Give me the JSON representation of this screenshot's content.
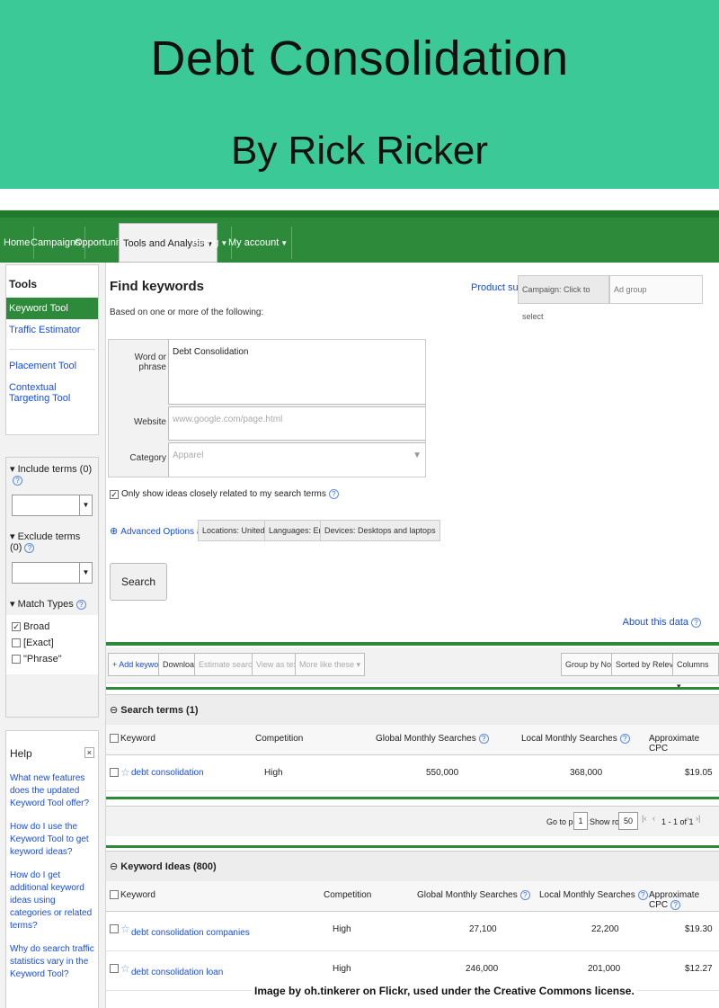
{
  "cover": {
    "title": "Debt Consolidation",
    "author": "By Rick Ricker",
    "bg_color": "#3bca97"
  },
  "nav": {
    "items": [
      "Home",
      "Campaigns",
      "Opportunities",
      "Tools and Analysis",
      "Billing",
      "My account"
    ],
    "active": "Tools and Analysis",
    "color": "#2d8a3a"
  },
  "sidebar": {
    "tools_title": "Tools",
    "tools": [
      "Keyword Tool",
      "Traffic Estimator",
      "Placement Tool",
      "Contextual Targeting Tool"
    ],
    "include_terms": "Include terms (0)",
    "exclude_terms": "Exclude terms (0)",
    "match_types_title": "Match Types",
    "match_types": [
      {
        "label": "Broad",
        "checked": true
      },
      {
        "label": "[Exact]",
        "checked": false
      },
      {
        "label": "\"Phrase\"",
        "checked": false
      }
    ],
    "help_title": "Help",
    "help_links": [
      "What new features does the updated Keyword Tool offer?",
      "How do I use the Keyword Tool to get keyword ideas?",
      "How do I get additional keyword ideas using categories or related terms?",
      "Why do search traffic statistics vary in the Keyword Tool?"
    ]
  },
  "find": {
    "title": "Find keywords",
    "subtitle": "Based on one or more of the following:",
    "product_survey": "Product survey",
    "campaign": "Campaign: Click to select",
    "ad_group": "Ad group",
    "word_label": "Word or phrase",
    "word_value": "Debt Consolidation",
    "website_label": "Website",
    "website_placeholder": "www.google.com/page.html",
    "category_label": "Category",
    "category_placeholder": "Apparel",
    "only_show": "Only show ideas closely related to my search terms",
    "advanced": "Advanced Options and Filters",
    "chips": [
      "Locations: United States",
      "Languages: English",
      "Devices: Desktops and laptops"
    ],
    "search_button": "Search",
    "about": "About this data"
  },
  "toolbar": {
    "add_keywords": "Add keywords",
    "download": "Download",
    "estimate": "Estimate search traffic",
    "view_as_text": "View as text",
    "more_like_these": "More like these",
    "group_by": "Group by None",
    "sorted_by": "Sorted by Relevance",
    "columns": "Columns"
  },
  "search_terms": {
    "title": "Search terms (1)",
    "headers": [
      "Keyword",
      "Competition",
      "Global Monthly Searches",
      "Local Monthly Searches",
      "Approximate CPC"
    ],
    "rows": [
      {
        "keyword": "debt consolidation",
        "competition": "High",
        "global": "550,000",
        "local": "368,000",
        "cpc": "$19.05"
      }
    ]
  },
  "pager": {
    "go_to_page": "Go to page:",
    "page": "1",
    "show_rows": "Show rows:",
    "rows": "50",
    "range": "1 - 1 of 1"
  },
  "keyword_ideas": {
    "title": "Keyword Ideas (800)",
    "headers": [
      "Keyword",
      "Competition",
      "Global Monthly Searches",
      "Local Monthly Searches",
      "Approximate CPC"
    ],
    "rows": [
      {
        "keyword": "debt consolidation companies",
        "competition": "High",
        "global": "27,100",
        "local": "22,200",
        "cpc": "$19.30"
      },
      {
        "keyword": "debt consolidation loan",
        "competition": "High",
        "global": "246,000",
        "local": "201,000",
        "cpc": "$12.27"
      }
    ]
  },
  "credit": "Image by oh.tinkerer on Flickr, used under the Creative Commons license."
}
